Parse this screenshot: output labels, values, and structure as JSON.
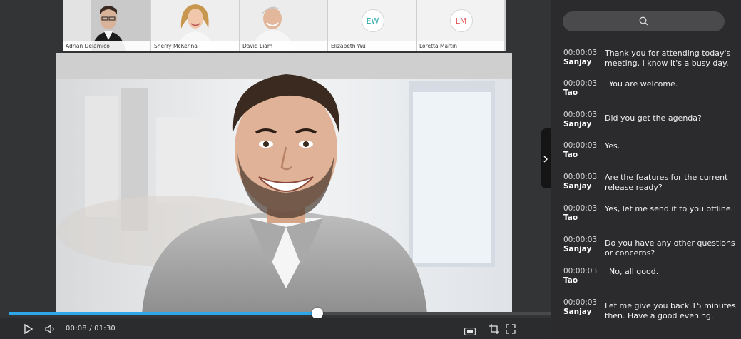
{
  "participants": [
    {
      "name": "Adrian Delamico",
      "type": "photo"
    },
    {
      "name": "Sherry McKenna",
      "type": "photo"
    },
    {
      "name": "David Liam",
      "type": "photo"
    },
    {
      "name": "Elizabeth Wu",
      "type": "initials",
      "initials": "EW"
    },
    {
      "name": "Loretta Martin",
      "type": "initials",
      "initials": "LM"
    }
  ],
  "player": {
    "time": "00:08 / 01:30",
    "progress_percent": 57,
    "icons": [
      "play-icon",
      "volume-icon",
      "captions-icon",
      "crop-icon",
      "fullscreen-icon"
    ]
  },
  "panel": {
    "search_icon": "search-icon",
    "transcript": [
      {
        "time": "00:00:03",
        "speaker": "Sanjay",
        "text": "Thank you for attending today's meeting. I know it's a busy day."
      },
      {
        "time": "00:00:03",
        "speaker": "Tao",
        "text": "You are welcome."
      },
      {
        "time": "00:00:03",
        "speaker": "Sanjay",
        "text": "Did you get the agenda?"
      },
      {
        "time": "00:00:03",
        "speaker": "Tao",
        "text": "Yes."
      },
      {
        "time": "00:00:03",
        "speaker": "Sanjay",
        "text": "Are the features for the current release ready?"
      },
      {
        "time": "00:00:03",
        "speaker": "Tao",
        "text": "Yes, let me send it to you offline."
      },
      {
        "time": "00:00:03",
        "speaker": "Sanjay",
        "text": "Do you have any other questions or concerns?"
      },
      {
        "time": "00:00:03",
        "speaker": "Tao",
        "text": "No, all good."
      },
      {
        "time": "00:00:03",
        "speaker": "Sanjay",
        "text": "Let me give you back 15 minutes then. Have a good evening."
      }
    ]
  },
  "colors": {
    "accent": "#2ea6ea",
    "initials_ew": "#2aa6a6",
    "initials_lm": "#e15353"
  }
}
